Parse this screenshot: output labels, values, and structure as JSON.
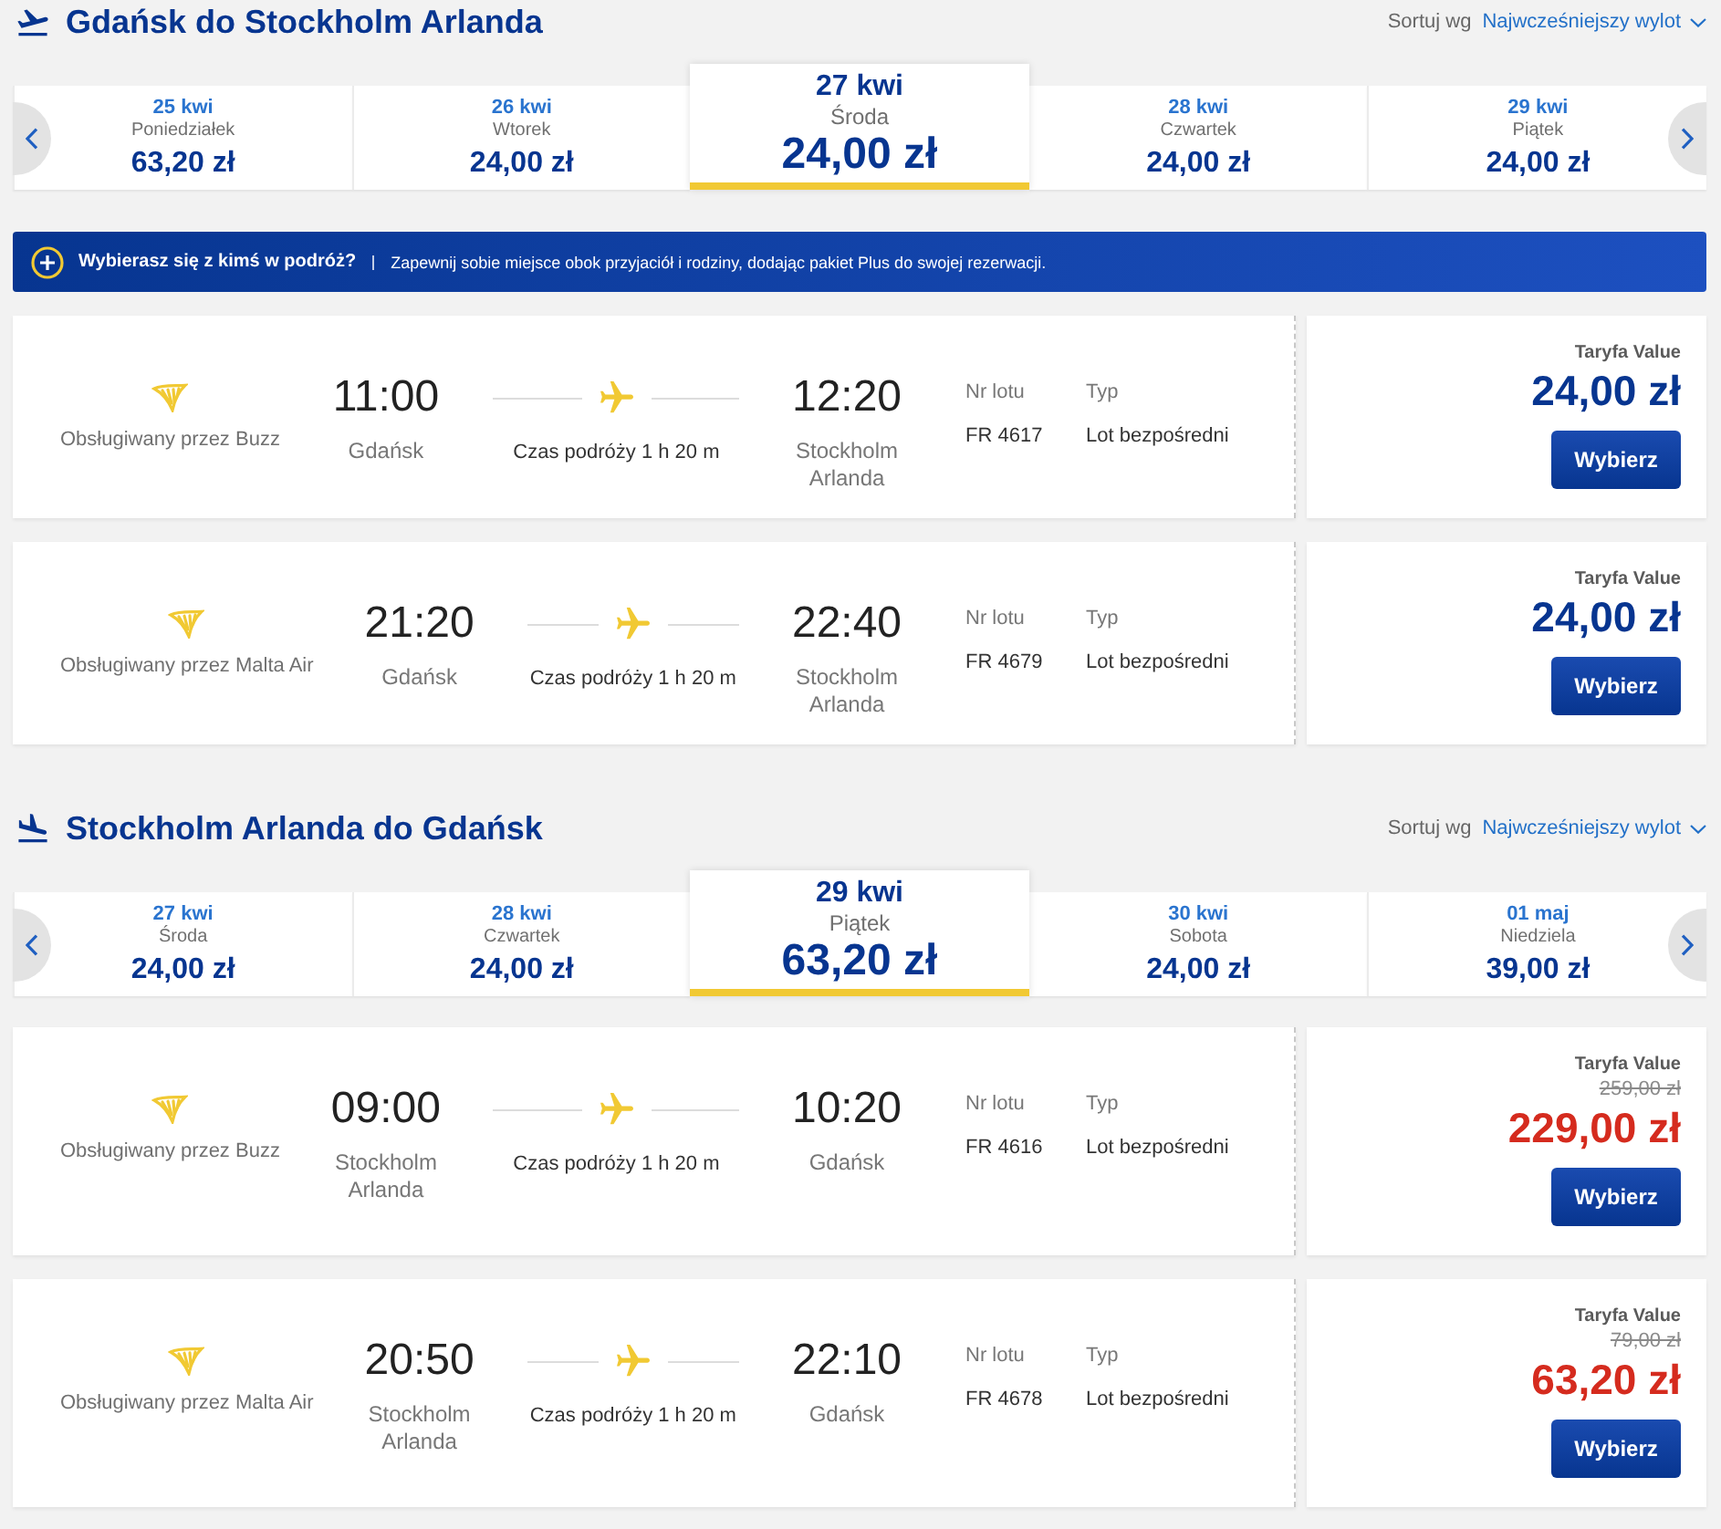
{
  "sections": [
    {
      "kind": "outbound",
      "title": "Gdańsk do Stockholm Arlanda",
      "sort_label": "Sortuj wg",
      "sort_value": "Najwcześniejszy wylot",
      "dates": [
        {
          "date": "25 kwi",
          "day": "Poniedziałek",
          "price": "63,20 zł",
          "selected": false
        },
        {
          "date": "26 kwi",
          "day": "Wtorek",
          "price": "24,00 zł",
          "selected": false
        },
        {
          "date": "27 kwi",
          "day": "Środa",
          "price": "24,00 zł",
          "selected": true
        },
        {
          "date": "28 kwi",
          "day": "Czwartek",
          "price": "24,00 zł",
          "selected": false
        },
        {
          "date": "29 kwi",
          "day": "Piątek",
          "price": "24,00 zł",
          "selected": false
        }
      ],
      "banner": {
        "title": "Wybierasz się z kimś w podróż?",
        "text": "Zapewnij sobie miejsce obok przyjaciół i rodziny, dodając pakiet Plus do swojej rezerwacji."
      },
      "flights": [
        {
          "operator": "Obsługiwany przez Buzz",
          "depart_time": "11:00",
          "depart_city": "Gdańsk",
          "duration": "Czas podróży 1 h 20 m",
          "arrive_time": "12:20",
          "arrive_city": "Stockholm Arlanda",
          "flight_no_label": "Nr lotu",
          "flight_no": "FR 4617",
          "type_label": "Typ",
          "type": "Lot bezpośredni",
          "fare_label": "Taryfa Value",
          "price": "24,00 zł",
          "discounted": false,
          "button": "Wybierz"
        },
        {
          "operator": "Obsługiwany przez Malta Air",
          "depart_time": "21:20",
          "depart_city": "Gdańsk",
          "duration": "Czas podróży 1 h 20 m",
          "arrive_time": "22:40",
          "arrive_city": "Stockholm Arlanda",
          "flight_no_label": "Nr lotu",
          "flight_no": "FR 4679",
          "type_label": "Typ",
          "type": "Lot bezpośredni",
          "fare_label": "Taryfa Value",
          "price": "24,00 zł",
          "discounted": false,
          "button": "Wybierz"
        }
      ]
    },
    {
      "kind": "inbound",
      "title": "Stockholm Arlanda do Gdańsk",
      "sort_label": "Sortuj wg",
      "sort_value": "Najwcześniejszy wylot",
      "dates": [
        {
          "date": "27 kwi",
          "day": "Środa",
          "price": "24,00 zł",
          "selected": false
        },
        {
          "date": "28 kwi",
          "day": "Czwartek",
          "price": "24,00 zł",
          "selected": false
        },
        {
          "date": "29 kwi",
          "day": "Piątek",
          "price": "63,20 zł",
          "selected": true
        },
        {
          "date": "30 kwi",
          "day": "Sobota",
          "price": "24,00 zł",
          "selected": false
        },
        {
          "date": "01 maj",
          "day": "Niedziela",
          "price": "39,00 zł",
          "selected": false
        }
      ],
      "flights": [
        {
          "operator": "Obsługiwany przez Buzz",
          "depart_time": "09:00",
          "depart_city": "Stockholm Arlanda",
          "duration": "Czas podróży 1 h 20 m",
          "arrive_time": "10:20",
          "arrive_city": "Gdańsk",
          "flight_no_label": "Nr lotu",
          "flight_no": "FR 4616",
          "type_label": "Typ",
          "type": "Lot bezpośredni",
          "fare_label": "Taryfa Value",
          "old_price": "259,00 zł",
          "price": "229,00 zł",
          "discounted": true,
          "button": "Wybierz"
        },
        {
          "operator": "Obsługiwany przez Malta Air",
          "depart_time": "20:50",
          "depart_city": "Stockholm Arlanda",
          "duration": "Czas podróży 1 h 20 m",
          "arrive_time": "22:10",
          "arrive_city": "Gdańsk",
          "flight_no_label": "Nr lotu",
          "flight_no": "FR 4678",
          "type_label": "Typ",
          "type": "Lot bezpośredni",
          "fare_label": "Taryfa Value",
          "old_price": "79,00 zł",
          "price": "63,20 zł",
          "discounted": true,
          "button": "Wybierz"
        }
      ]
    }
  ]
}
